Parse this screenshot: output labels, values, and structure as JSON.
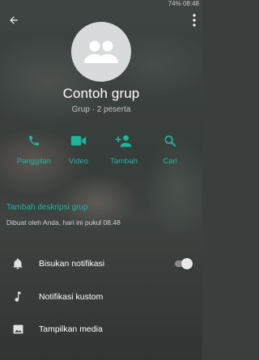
{
  "status_bar": {
    "text": "74% 08:48"
  },
  "header": {
    "back_icon": "arrow-left-icon",
    "more_icon": "more-vert-icon"
  },
  "group": {
    "avatar_icon": "group-icon",
    "name": "Contoh grup",
    "subtitle": "Grup · 2 peserta"
  },
  "actions": [
    {
      "label": "Panggilan",
      "icon": "phone-icon"
    },
    {
      "label": "Video",
      "icon": "videocam-icon"
    },
    {
      "label": "Tambah",
      "icon": "person-add-icon"
    },
    {
      "label": "Cari",
      "icon": "search-icon"
    }
  ],
  "description": {
    "add_label": "Tambah deskripsi grup",
    "created_text": "Dibuat oleh Anda, hari ini pukul 08.48"
  },
  "settings": [
    {
      "label": "Bisukan notifikasi",
      "icon": "notifications-icon",
      "toggle": false
    },
    {
      "label": "Notifikasi kustom",
      "icon": "music-note-icon"
    },
    {
      "label": "Tampilkan media",
      "icon": "image-icon"
    }
  ],
  "colors": {
    "accent": "#1fb59b",
    "avatar_bg": "#d7dbdc",
    "avatar_fg": "#ffffff"
  }
}
